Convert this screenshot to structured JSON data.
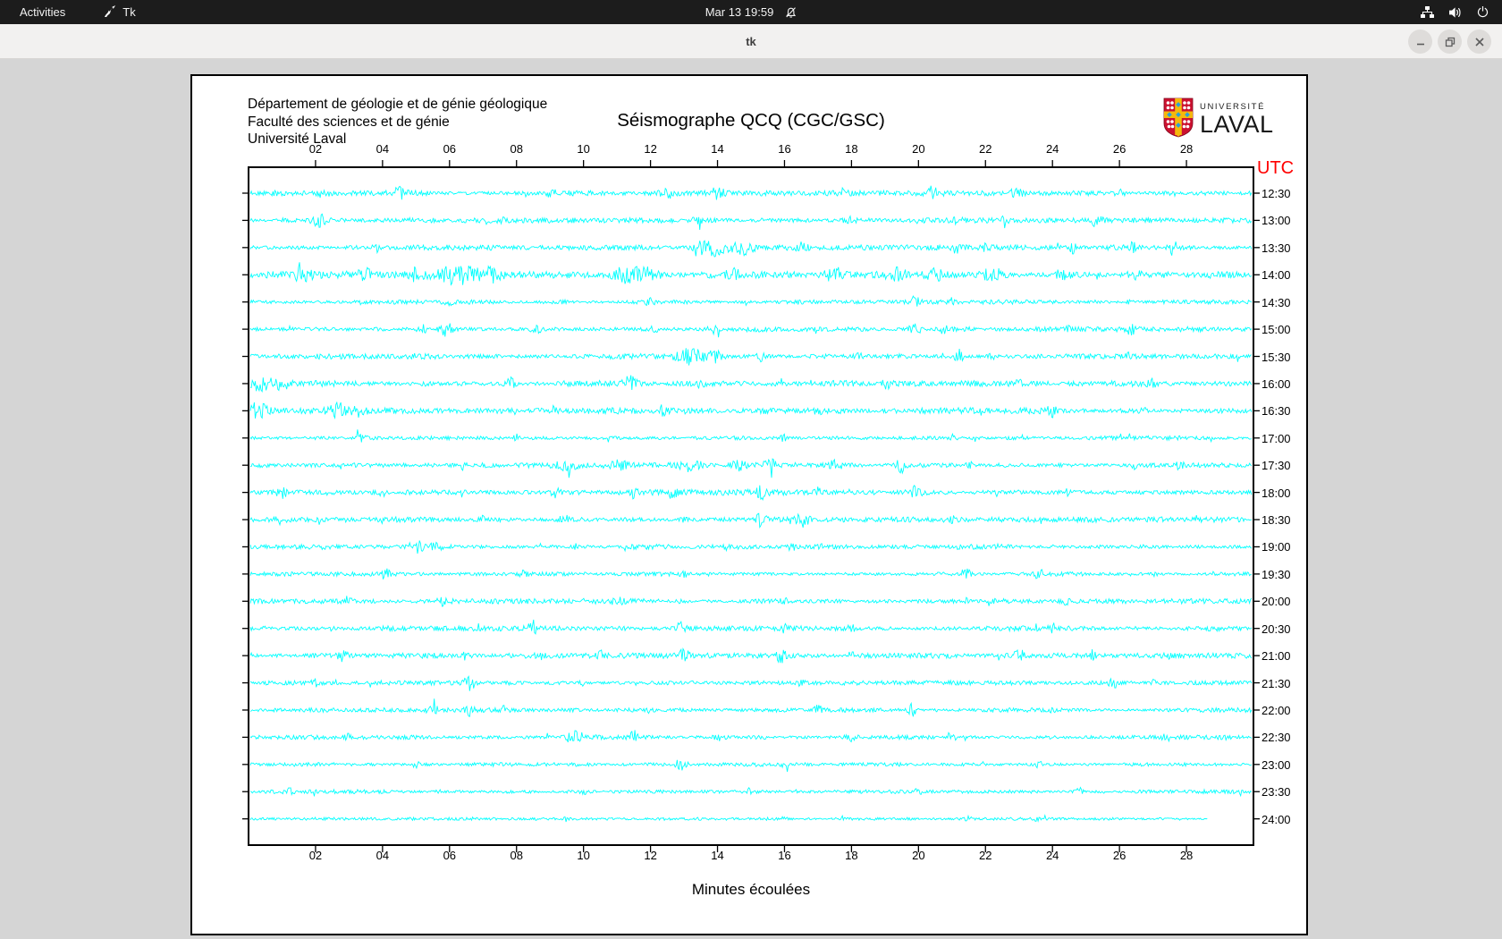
{
  "desktop": {
    "activities_label": "Activities",
    "app_name": "Tk",
    "clock": "Mar 13 19:59",
    "status_icons": [
      "notifications-disabled-icon",
      "network-nodes-icon",
      "volume-icon",
      "power-icon"
    ]
  },
  "window": {
    "title": "tk",
    "controls": [
      "minimize",
      "restore",
      "close"
    ]
  },
  "doc": {
    "header_lines": [
      "Département de géologie et de génie géologique",
      "Faculté des sciences et de génie",
      "Université Laval"
    ],
    "title": "Séismographe QCQ (CGC/GSC)",
    "logo": {
      "univ": "UNIVERSITÉ",
      "name": "LAVAL"
    },
    "utc_label": "UTC",
    "xlabel": "Minutes écoulées",
    "colors": {
      "trace": "#00ffff",
      "utc": "#ff0000",
      "axis": "#000000"
    }
  },
  "chart_data": {
    "type": "line",
    "subtype": "seismogram-helicorder",
    "station": "QCQ (CGC/GSC)",
    "x_axis": {
      "label": "Minutes écoulées",
      "range_minutes": [
        0,
        30
      ]
    },
    "minute_ticks": [
      "02",
      "04",
      "06",
      "08",
      "10",
      "12",
      "14",
      "16",
      "18",
      "20",
      "22",
      "24",
      "26",
      "28"
    ],
    "y_axis": {
      "label": "UTC",
      "position": "right"
    },
    "utc_rows": [
      {
        "label": "12:30",
        "amp": 2.4,
        "events": [
          [
            2.2,
            0.15,
            4
          ],
          [
            4.5,
            0.2,
            5
          ],
          [
            9,
            0.15,
            4
          ],
          [
            12.5,
            0.2,
            4
          ],
          [
            14,
            0.25,
            5
          ],
          [
            17.7,
            0.15,
            4
          ],
          [
            20.4,
            0.2,
            6
          ],
          [
            22.9,
            0.2,
            5
          ],
          [
            26,
            0.15,
            4
          ]
        ]
      },
      {
        "label": "13:00",
        "amp": 2.4,
        "events": [
          [
            2.1,
            0.2,
            6
          ],
          [
            7.5,
            0.1,
            3
          ],
          [
            13.4,
            0.15,
            4
          ],
          [
            18,
            0.1,
            3
          ],
          [
            21.2,
            0.1,
            4
          ],
          [
            22.6,
            0.08,
            9
          ],
          [
            25.3,
            0.15,
            5
          ]
        ]
      },
      {
        "label": "13:30",
        "amp": 2.4,
        "events": [
          [
            3.8,
            0.1,
            4
          ],
          [
            13.8,
            0.5,
            9
          ],
          [
            14.8,
            0.3,
            7
          ],
          [
            16.5,
            0.15,
            5
          ],
          [
            21.1,
            0.1,
            7
          ],
          [
            22,
            0.1,
            5
          ],
          [
            24.6,
            0.1,
            5
          ],
          [
            26.4,
            0.1,
            5
          ],
          [
            27.6,
            0.12,
            8
          ]
        ]
      },
      {
        "label": "14:00",
        "amp": 3.2,
        "events": [
          [
            1.6,
            0.3,
            5
          ],
          [
            3.5,
            0.2,
            5
          ],
          [
            5,
            0.2,
            6
          ],
          [
            6.3,
            0.6,
            9
          ],
          [
            7.3,
            0.3,
            8
          ],
          [
            11.6,
            0.7,
            9
          ],
          [
            14.5,
            0.2,
            4
          ],
          [
            17.5,
            0.3,
            6
          ],
          [
            19.3,
            0.3,
            7
          ],
          [
            20.5,
            0.2,
            5
          ],
          [
            22.2,
            0.3,
            6
          ],
          [
            24.3,
            0.2,
            5
          ],
          [
            26.5,
            0.2,
            4
          ]
        ]
      },
      {
        "label": "14:30",
        "amp": 2.0,
        "events": [
          [
            6,
            0.2,
            3
          ],
          [
            12,
            0.2,
            3
          ],
          [
            19.9,
            0.15,
            5
          ],
          [
            21,
            0.15,
            4
          ],
          [
            26.3,
            0.1,
            3
          ]
        ]
      },
      {
        "label": "15:00",
        "amp": 2.4,
        "events": [
          [
            5.2,
            0.15,
            5
          ],
          [
            5.9,
            0.2,
            7
          ],
          [
            8.6,
            0.15,
            5
          ],
          [
            12.1,
            0.1,
            4
          ],
          [
            13.9,
            0.15,
            5
          ],
          [
            19.9,
            0.15,
            6
          ],
          [
            20.8,
            0.15,
            5
          ],
          [
            24.5,
            0.1,
            4
          ],
          [
            26.3,
            0.15,
            6
          ]
        ]
      },
      {
        "label": "15:30",
        "amp": 2.4,
        "events": [
          [
            13.2,
            0.4,
            8
          ],
          [
            13.9,
            0.2,
            6
          ],
          [
            15.3,
            0.15,
            5
          ],
          [
            18.2,
            0.1,
            4
          ],
          [
            21.2,
            0.12,
            7
          ],
          [
            22.2,
            0.1,
            5
          ],
          [
            26.2,
            0.1,
            4
          ]
        ]
      },
      {
        "label": "16:00",
        "amp": 2.8,
        "events": [
          [
            0.4,
            0.3,
            8
          ],
          [
            1,
            0.2,
            5
          ],
          [
            5.3,
            0.15,
            4
          ],
          [
            7.8,
            0.15,
            6
          ],
          [
            11.4,
            0.2,
            7
          ],
          [
            13.5,
            0.1,
            4
          ],
          [
            19,
            0.15,
            5
          ],
          [
            23,
            0.1,
            4
          ],
          [
            27,
            0.1,
            4
          ]
        ]
      },
      {
        "label": "16:30",
        "amp": 2.8,
        "events": [
          [
            0.3,
            0.3,
            9
          ],
          [
            2.7,
            0.25,
            7
          ],
          [
            3.3,
            0.2,
            6
          ],
          [
            9.1,
            0.1,
            4
          ],
          [
            12.4,
            0.15,
            5
          ],
          [
            17,
            0.1,
            3
          ],
          [
            24,
            0.15,
            5
          ],
          [
            26.7,
            0.1,
            4
          ]
        ]
      },
      {
        "label": "17:00",
        "amp": 2.0,
        "events": [
          [
            3.3,
            0.15,
            4
          ],
          [
            8,
            0.1,
            3
          ],
          [
            16,
            0.1,
            3
          ],
          [
            21,
            0.1,
            3
          ],
          [
            26,
            0.1,
            3
          ]
        ]
      },
      {
        "label": "17:30",
        "amp": 2.4,
        "events": [
          [
            6.4,
            0.1,
            4
          ],
          [
            9.5,
            0.3,
            5
          ],
          [
            11,
            0.3,
            5
          ],
          [
            13.2,
            0.3,
            6
          ],
          [
            14.6,
            0.2,
            5
          ],
          [
            15.6,
            0.2,
            6
          ],
          [
            17.5,
            0.2,
            5
          ],
          [
            19.5,
            0.15,
            7
          ],
          [
            21.5,
            0.1,
            4
          ],
          [
            26.4,
            0.1,
            4
          ],
          [
            27.8,
            0.1,
            5
          ]
        ]
      },
      {
        "label": "18:00",
        "amp": 2.8,
        "events": [
          [
            1,
            0.15,
            5
          ],
          [
            4,
            0.1,
            4
          ],
          [
            9.2,
            0.15,
            6
          ],
          [
            11.5,
            0.1,
            5
          ],
          [
            12.6,
            0.15,
            6
          ],
          [
            15.3,
            0.12,
            6
          ],
          [
            17,
            0.1,
            4
          ],
          [
            19.9,
            0.15,
            6
          ],
          [
            24.5,
            0.1,
            4
          ]
        ]
      },
      {
        "label": "18:30",
        "amp": 2.4,
        "events": [
          [
            0.9,
            0.15,
            4
          ],
          [
            7,
            0.1,
            3
          ],
          [
            9.4,
            0.15,
            5
          ],
          [
            13,
            0.1,
            4
          ],
          [
            15.3,
            0.15,
            6
          ],
          [
            16.5,
            0.2,
            7
          ],
          [
            21,
            0.1,
            3
          ]
        ]
      },
      {
        "label": "19:00",
        "amp": 2.4,
        "events": [
          [
            5,
            0.25,
            6
          ],
          [
            5.6,
            0.15,
            4
          ],
          [
            9.8,
            0.1,
            4
          ],
          [
            14.2,
            0.1,
            3
          ],
          [
            16.3,
            0.2,
            5
          ],
          [
            17,
            0.15,
            4
          ],
          [
            22.5,
            0.1,
            3
          ]
        ]
      },
      {
        "label": "19:30",
        "amp": 2.0,
        "events": [
          [
            4.1,
            0.15,
            5
          ],
          [
            8.2,
            0.1,
            3
          ],
          [
            13,
            0.1,
            3
          ],
          [
            21.4,
            0.15,
            5
          ],
          [
            23.6,
            0.12,
            5
          ],
          [
            27,
            0.1,
            3
          ]
        ]
      },
      {
        "label": "20:00",
        "amp": 2.4,
        "events": [
          [
            3,
            0.1,
            3
          ],
          [
            5.8,
            0.15,
            4
          ],
          [
            11,
            0.15,
            4
          ],
          [
            16,
            0.1,
            3
          ],
          [
            21.4,
            0.1,
            4
          ],
          [
            24.4,
            0.1,
            3
          ]
        ]
      },
      {
        "label": "20:30",
        "amp": 2.4,
        "events": [
          [
            2.5,
            0.1,
            3
          ],
          [
            8.5,
            0.15,
            7
          ],
          [
            12.9,
            0.12,
            5
          ],
          [
            16,
            0.1,
            3
          ],
          [
            18,
            0.12,
            4
          ],
          [
            24,
            0.1,
            4
          ]
        ]
      },
      {
        "label": "21:00",
        "amp": 2.4,
        "events": [
          [
            2.8,
            0.15,
            5
          ],
          [
            6.5,
            0.1,
            4
          ],
          [
            10.5,
            0.1,
            4
          ],
          [
            13,
            0.15,
            7
          ],
          [
            15.9,
            0.12,
            7
          ],
          [
            18,
            0.1,
            4
          ],
          [
            23,
            0.15,
            6
          ],
          [
            25.2,
            0.1,
            5
          ],
          [
            27.5,
            0.1,
            4
          ]
        ]
      },
      {
        "label": "21:30",
        "amp": 2.0,
        "events": [
          [
            2,
            0.1,
            3
          ],
          [
            6.6,
            0.15,
            8
          ],
          [
            10,
            0.1,
            3
          ],
          [
            16.5,
            0.1,
            3
          ],
          [
            25.8,
            0.12,
            8
          ],
          [
            27,
            0.1,
            3
          ]
        ]
      },
      {
        "label": "22:00",
        "amp": 2.0,
        "events": [
          [
            5.5,
            0.15,
            6
          ],
          [
            6.6,
            0.12,
            5
          ],
          [
            12,
            0.1,
            3
          ],
          [
            17,
            0.15,
            4
          ],
          [
            19.8,
            0.1,
            8
          ],
          [
            24,
            0.1,
            3
          ]
        ]
      },
      {
        "label": "22:30",
        "amp": 2.0,
        "events": [
          [
            3,
            0.1,
            3
          ],
          [
            9.7,
            0.2,
            7
          ],
          [
            11.5,
            0.15,
            6
          ],
          [
            14,
            0.1,
            3
          ],
          [
            18,
            0.15,
            4
          ],
          [
            21,
            0.1,
            4
          ],
          [
            27.4,
            0.12,
            5
          ]
        ]
      },
      {
        "label": "23:00",
        "amp": 1.8,
        "events": [
          [
            5,
            0.1,
            3
          ],
          [
            12.9,
            0.15,
            6
          ],
          [
            16,
            0.1,
            3
          ],
          [
            23.6,
            0.12,
            4
          ]
        ]
      },
      {
        "label": "23:30",
        "amp": 1.8,
        "events": [
          [
            1.2,
            0.12,
            4
          ],
          [
            5.6,
            0.1,
            4
          ],
          [
            10,
            0.1,
            3
          ],
          [
            15,
            0.1,
            3
          ],
          [
            20,
            0.12,
            4
          ],
          [
            24.8,
            0.1,
            4
          ]
        ]
      },
      {
        "label": "24:00",
        "amp": 1.3,
        "end": 28.7,
        "events": [
          [
            4.8,
            0.1,
            2
          ],
          [
            9.5,
            0.1,
            2
          ],
          [
            16,
            0.1,
            2
          ],
          [
            21.5,
            0.1,
            2
          ],
          [
            23.5,
            0.1,
            2
          ]
        ]
      }
    ]
  }
}
